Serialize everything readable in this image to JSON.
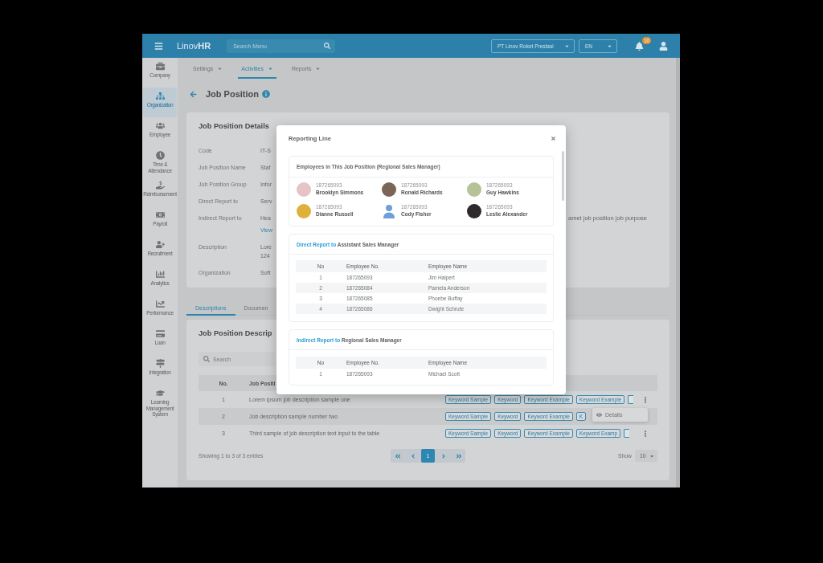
{
  "topbar": {
    "logo": "Linov**HR**",
    "search": {
      "placeholder": "Search Menu"
    },
    "company": "PT Linov Roket Prestasi",
    "language": "EN",
    "notification_count": "10"
  },
  "sidebar": {
    "items": [
      {
        "label": "Company",
        "selected": false
      },
      {
        "label": "Organization",
        "selected": true
      },
      {
        "label": "Employee",
        "selected": false
      },
      {
        "label": "Time & Attendance",
        "selected": false
      },
      {
        "label": "Reimbursement",
        "selected": false
      },
      {
        "label": "Payroll",
        "selected": false
      },
      {
        "label": "Recruitment",
        "selected": false
      },
      {
        "label": "Analytics",
        "selected": false
      },
      {
        "label": "Performance",
        "selected": false
      },
      {
        "label": "Loan",
        "selected": false
      },
      {
        "label": "Integration",
        "selected": false
      },
      {
        "label": "Learning Management System",
        "selected": false
      }
    ]
  },
  "subnav": [
    {
      "label": "Settings",
      "selected": false
    },
    {
      "label": "Activities",
      "selected": true
    },
    {
      "label": "Reports",
      "selected": false
    }
  ],
  "page_title": "Job Position",
  "details": {
    "title": "Job Position Details",
    "fields": [
      {
        "label": "Code",
        "values": [
          {
            "text": "IT-S",
            "kind": "text"
          }
        ]
      },
      {
        "label": "Job Position Name",
        "values": [
          {
            "text": "Staf",
            "kind": "text"
          }
        ]
      },
      {
        "label": "Job Position Group",
        "values": [
          {
            "text": "Infor",
            "kind": "text"
          }
        ]
      },
      {
        "label": "Direct Report to",
        "values": [
          {
            "text": "Serv",
            "kind": "text"
          }
        ]
      },
      {
        "label": "Indirect Report to",
        "values": [
          {
            "text": "Hea",
            "kind": "text"
          },
          {
            "text": "View",
            "kind": "link"
          }
        ],
        "side_text": "amet job position job purpose"
      },
      {
        "label": "Description",
        "values": [
          {
            "text": "Lore",
            "kind": "text"
          },
          {
            "text": "124",
            "kind": "text"
          }
        ]
      },
      {
        "label": "Organization",
        "values": [
          {
            "text": "Soft",
            "kind": "text"
          }
        ]
      }
    ]
  },
  "tabs": [
    {
      "label": "Descriptions",
      "selected": true
    },
    {
      "label": "Documen",
      "selected": false
    }
  ],
  "descriptions": {
    "title": "Job Position Descrip",
    "search": {
      "placeholder": "Search"
    },
    "columns": [
      "No.",
      "Job Positi"
    ],
    "rows": [
      {
        "no": "1",
        "text": "Lorem ipsum job description sample one",
        "keywords": [
          "Keyword Sample",
          "Keyword",
          "Keyword Example",
          "Keyword Example"
        ],
        "more_tags": true,
        "menu_open": false
      },
      {
        "no": "2",
        "text": "Job description sample number two",
        "keywords": [
          "Keyword Sample",
          "Keyword",
          "Keyword Example",
          "K"
        ],
        "more_tags": false,
        "menu_open": true
      },
      {
        "no": "3",
        "text": "Third sample of job description text input to the table",
        "keywords": [
          "Keyword Sample",
          "Keyword",
          "Keyword Example",
          "Keyword Examp"
        ],
        "more_tags": true,
        "menu_open": false
      }
    ],
    "row_menu": {
      "label": "Details"
    },
    "entries": "Showing 1 to 3 of 3 entries",
    "pages": [
      {
        "label": "1",
        "selected": true
      }
    ],
    "show_label": "Show",
    "page_size": "10"
  },
  "modal": {
    "title": "Reporting Line",
    "employees_title": "Employees in This Job Position (Regional Sales Manager)",
    "employees": [
      {
        "number": "187265093",
        "name": "Brooklyn Simmons",
        "kind": "photo"
      },
      {
        "number": "187265093",
        "name": "Ronald Richards",
        "kind": "photo"
      },
      {
        "number": "187265093",
        "name": "Guy Hawkins",
        "kind": "photo"
      },
      {
        "number": "187265093",
        "name": "Dianne Russell",
        "kind": "photo"
      },
      {
        "number": "187265093",
        "name": "Cody Fisher",
        "kind": "silhouette"
      },
      {
        "number": "187265093",
        "name": "Leslie Alexander",
        "kind": "photo"
      }
    ],
    "reports": [
      {
        "relation": "Direct Report to",
        "position": "Assistant Sales Manager",
        "columns": [
          "No",
          "Employee No.",
          "Employee Name"
        ],
        "rows": [
          {
            "no": "1",
            "number": "187265093",
            "name": "Jim Halpert"
          },
          {
            "no": "2",
            "number": "187265084",
            "name": "Pamela Anderson"
          },
          {
            "no": "3",
            "number": "187265085",
            "name": "Phoebe Buffay"
          },
          {
            "no": "4",
            "number": "187265086",
            "name": "Dwight Schrute"
          }
        ]
      },
      {
        "relation": "Indirect Report to",
        "position": "Regional Sales Manager",
        "columns": [
          "No",
          "Employee No.",
          "Employee Name"
        ],
        "rows": [
          {
            "no": "1",
            "number": "187265093",
            "name": "Michael Scott"
          }
        ]
      }
    ]
  }
}
